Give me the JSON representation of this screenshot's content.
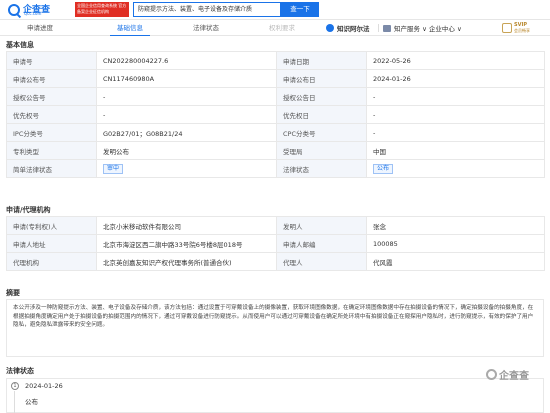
{
  "header": {
    "logo_text": "企查查",
    "logo_domain": "Qcc.com",
    "logo_badge": "全国企业信用查询系统 官方备案企业征信机构",
    "search_value": "防窥提示方法、装置、电子设备及存储介质",
    "search_button": "查一下"
  },
  "tabs": {
    "progress": "申请进度",
    "info": "基础信息",
    "legal": "法律状态",
    "rights": "权利要求",
    "zhiguo": "知识阿尔法",
    "jiyuanyuan": "知产服务 ∨  企业中心 ∨",
    "svip_title": "SVIP",
    "svip_sub": "会员畅享"
  },
  "basic": {
    "title": "基本信息",
    "rows": [
      [
        "申请号",
        "CN202280004227.6",
        "申请日期",
        "2022-05-26"
      ],
      [
        "申请公布号",
        "CN117460980A",
        "申请公布日",
        "2024-01-26"
      ],
      [
        "授权公告号",
        "-",
        "授权公告日",
        "-"
      ],
      [
        "优先权号",
        "-",
        "优先权日",
        "-"
      ],
      [
        "IPC分类号",
        "G02B27/01；G08B21/24",
        "CPC分类号",
        "-"
      ],
      [
        "专利类型",
        "发明公布",
        "受理局",
        "中国"
      ],
      [
        "简单法律状态",
        "审中",
        "法律状态",
        "公布"
      ]
    ]
  },
  "agent": {
    "title": "申请/代理机构",
    "rows": [
      [
        "申请(专利权)人",
        "北京小米移动软件有限公司",
        "发明人",
        "张念"
      ],
      [
        "申请人地址",
        "北京市海淀区西二旗中路33号院6号楼8层018号",
        "申请人邮编",
        "100085"
      ],
      [
        "代理机构",
        "北京英创嘉友知识产权代理事务所(普通合伙)",
        "代理人",
        "代风霞"
      ]
    ]
  },
  "abstract": {
    "title": "摘要",
    "text": "本公开涉及一种防窥提示方法、装置、电子设备及存储介质，该方法包括：通过设置于可穿戴设备上的摄像装置，获取环境图像数据，在确定环境图像数据中存在拍摄设备的情况下，确定拍摄设备的拍摄角度，在根据拍摄角度确定用户处于拍摄设备的拍摄范围内的情况下，通过可穿戴设备进行防窥提示。从而使用户可以通过可穿戴设备在确定所处环境中有拍摄设备正在窥探用户隐私时，进行防窥提示，有效的保护了用户隐私，避免隐私泄露带来的安全问题。"
  },
  "legal": {
    "title": "法律状态",
    "index": "1",
    "date": "2024-01-26",
    "status": "公布"
  },
  "watermark": "企查查"
}
